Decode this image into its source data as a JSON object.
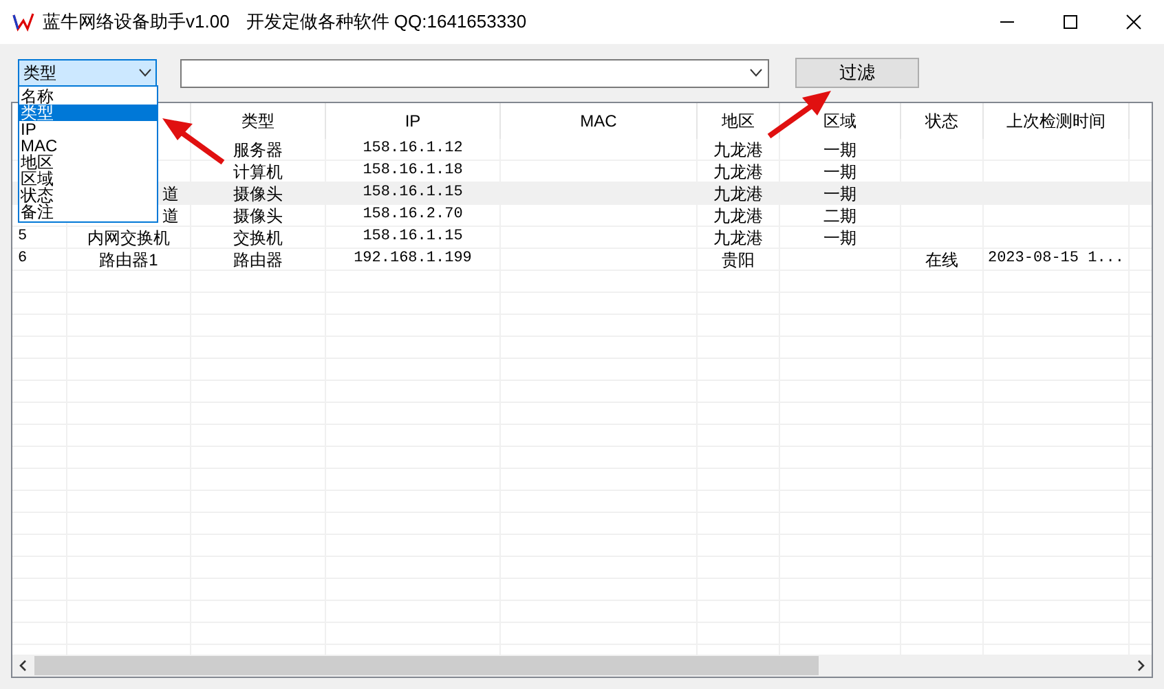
{
  "window": {
    "title": "蓝牛网络设备助手v1.00",
    "subtitle": "开发定做各种软件 QQ:1641653330"
  },
  "filter": {
    "field": {
      "value": "类型",
      "options": [
        {
          "label": "名称",
          "selected": false
        },
        {
          "label": "类型",
          "selected": true
        },
        {
          "label": "IP",
          "selected": false
        },
        {
          "label": "MAC",
          "selected": false
        },
        {
          "label": "地区",
          "selected": false
        },
        {
          "label": "区域",
          "selected": false
        },
        {
          "label": "状态",
          "selected": false
        },
        {
          "label": "备注",
          "selected": false
        }
      ]
    },
    "button": "过滤"
  },
  "table": {
    "columns": [
      "类型",
      "IP",
      "MAC",
      "地区",
      "区域",
      "状态",
      "上次检测时间"
    ],
    "rows": [
      {
        "type": "服务器",
        "ip": "158.16.1.12",
        "region": "九龙港",
        "area": "一期",
        "selected": false
      },
      {
        "type": "计算机",
        "ip": "158.16.1.18",
        "region": "九龙港",
        "area": "一期",
        "selected": false
      },
      {
        "name": "道",
        "type": "摄像头",
        "ip": "158.16.1.15",
        "region": "九龙港",
        "area": "一期",
        "selected": true
      },
      {
        "name": "道",
        "type": "摄像头",
        "ip": "158.16.2.70",
        "region": "九龙港",
        "area": "二期",
        "selected": false
      },
      {
        "id": "5",
        "name": "内网交换机",
        "type": "交换机",
        "ip": "158.16.1.15",
        "region": "九龙港",
        "area": "一期",
        "selected": false
      },
      {
        "id": "6",
        "name": "路由器1",
        "type": "路由器",
        "ip": "192.168.1.199",
        "region": "贵阳",
        "status": "在线",
        "last_check": "2023-08-15 1...",
        "selected": false
      }
    ]
  }
}
